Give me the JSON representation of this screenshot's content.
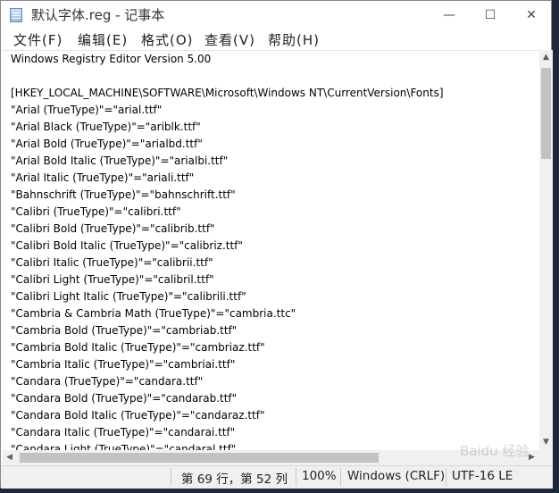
{
  "window": {
    "title": "默认字体.reg - 记事本",
    "minimize_glyph": "—",
    "maximize_glyph": "☐",
    "close_glyph": "✕"
  },
  "menu": [
    {
      "label": "文件(F)"
    },
    {
      "label": "编辑(E)"
    },
    {
      "label": "格式(O)"
    },
    {
      "label": "查看(V)"
    },
    {
      "label": "帮助(H)"
    }
  ],
  "editor": {
    "lines": [
      "Windows Registry Editor Version 5.00",
      "",
      "[HKEY_LOCAL_MACHINE\\SOFTWARE\\Microsoft\\Windows NT\\CurrentVersion\\Fonts]",
      "\"Arial (TrueType)\"=\"arial.ttf\"",
      "\"Arial Black (TrueType)\"=\"ariblk.ttf\"",
      "\"Arial Bold (TrueType)\"=\"arialbd.ttf\"",
      "\"Arial Bold Italic (TrueType)\"=\"arialbi.ttf\"",
      "\"Arial Italic (TrueType)\"=\"ariali.ttf\"",
      "\"Bahnschrift (TrueType)\"=\"bahnschrift.ttf\"",
      "\"Calibri (TrueType)\"=\"calibri.ttf\"",
      "\"Calibri Bold (TrueType)\"=\"calibrib.ttf\"",
      "\"Calibri Bold Italic (TrueType)\"=\"calibriz.ttf\"",
      "\"Calibri Italic (TrueType)\"=\"calibrii.ttf\"",
      "\"Calibri Light (TrueType)\"=\"calibril.ttf\"",
      "\"Calibri Light Italic (TrueType)\"=\"calibrili.ttf\"",
      "\"Cambria & Cambria Math (TrueType)\"=\"cambria.ttc\"",
      "\"Cambria Bold (TrueType)\"=\"cambriab.ttf\"",
      "\"Cambria Bold Italic (TrueType)\"=\"cambriaz.ttf\"",
      "\"Cambria Italic (TrueType)\"=\"cambriai.ttf\"",
      "\"Candara (TrueType)\"=\"candara.ttf\"",
      "\"Candara Bold (TrueType)\"=\"candarab.ttf\"",
      "\"Candara Bold Italic (TrueType)\"=\"candaraz.ttf\"",
      "\"Candara Italic (TrueType)\"=\"candarai.ttf\"",
      "\"Candara Light (TrueType)\"=\"candaral.ttf\""
    ]
  },
  "scrollbar": {
    "up_glyph": "▲",
    "down_glyph": "▼",
    "left_glyph": "◀",
    "right_glyph": "▶"
  },
  "status": {
    "position": "第 69 行，第 52 列",
    "zoom": "100%",
    "line_ending": "Windows (CRLF)",
    "encoding": "UTF-16 LE"
  },
  "watermark": {
    "text": "Baidu 经验"
  }
}
